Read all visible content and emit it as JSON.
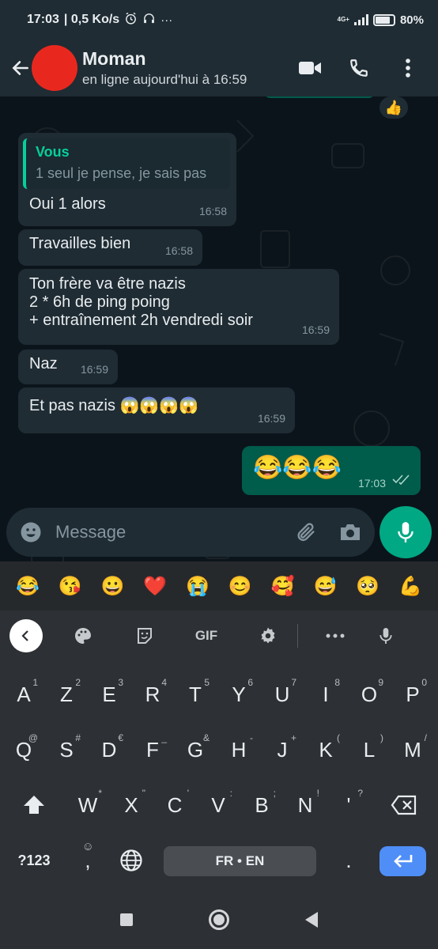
{
  "status_bar": {
    "time": "17:03",
    "speed": "| 0,5 Ko/s",
    "network": "4G+",
    "battery": "80%",
    "battery_level": 0.8
  },
  "header": {
    "contact_name": "Moman",
    "contact_status": "en ligne aujourd'hui à 16:59"
  },
  "chat": {
    "reaction_emoji": "👍",
    "messages": [
      {
        "type": "in",
        "quote_author": "Vous",
        "quote_text": "1 seul je pense, je sais pas",
        "text": "Oui 1 alors",
        "time": "16:58"
      },
      {
        "type": "in",
        "text": "Travailles bien",
        "time": "16:58"
      },
      {
        "type": "in",
        "text": "Ton frère va être nazis\n2 * 6h de ping poing\n+ entraînement 2h vendredi soir",
        "time": "16:59"
      },
      {
        "type": "in",
        "text": "Naz",
        "time": "16:59"
      },
      {
        "type": "in",
        "text": "Et pas nazis 😱😱😱😱",
        "time": "16:59"
      },
      {
        "type": "out",
        "text": "😂😂😂",
        "time": "17:03",
        "status": "read"
      }
    ]
  },
  "input": {
    "placeholder": "Message"
  },
  "emoji_suggestions": [
    "😂",
    "😘",
    "😀",
    "❤️",
    "😭",
    "😊",
    "🥰",
    "😅",
    "🥺",
    "💪"
  ],
  "keyboard_toolbar": {
    "gif_label": "GIF"
  },
  "keyboard": {
    "row1": [
      {
        "k": "A",
        "s": "1"
      },
      {
        "k": "Z",
        "s": "2"
      },
      {
        "k": "E",
        "s": "3"
      },
      {
        "k": "R",
        "s": "4"
      },
      {
        "k": "T",
        "s": "5"
      },
      {
        "k": "Y",
        "s": "6"
      },
      {
        "k": "U",
        "s": "7"
      },
      {
        "k": "I",
        "s": "8"
      },
      {
        "k": "O",
        "s": "9"
      },
      {
        "k": "P",
        "s": "0"
      }
    ],
    "row2": [
      {
        "k": "Q",
        "s": "@"
      },
      {
        "k": "S",
        "s": "#"
      },
      {
        "k": "D",
        "s": "€"
      },
      {
        "k": "F",
        "s": "_"
      },
      {
        "k": "G",
        "s": "&"
      },
      {
        "k": "H",
        "s": "-"
      },
      {
        "k": "J",
        "s": "+"
      },
      {
        "k": "K",
        "s": "("
      },
      {
        "k": "L",
        "s": ")"
      },
      {
        "k": "M",
        "s": "/"
      }
    ],
    "row3": [
      {
        "k": "W",
        "s": "*"
      },
      {
        "k": "X",
        "s": "\""
      },
      {
        "k": "C",
        "s": "'"
      },
      {
        "k": "V",
        "s": ":"
      },
      {
        "k": "B",
        "s": ";"
      },
      {
        "k": "N",
        "s": "!"
      },
      {
        "k": "'",
        "s": "?"
      }
    ],
    "symbols_label": "?123",
    "comma_label": ",",
    "space_label": "FR • EN",
    "period_label": "."
  }
}
